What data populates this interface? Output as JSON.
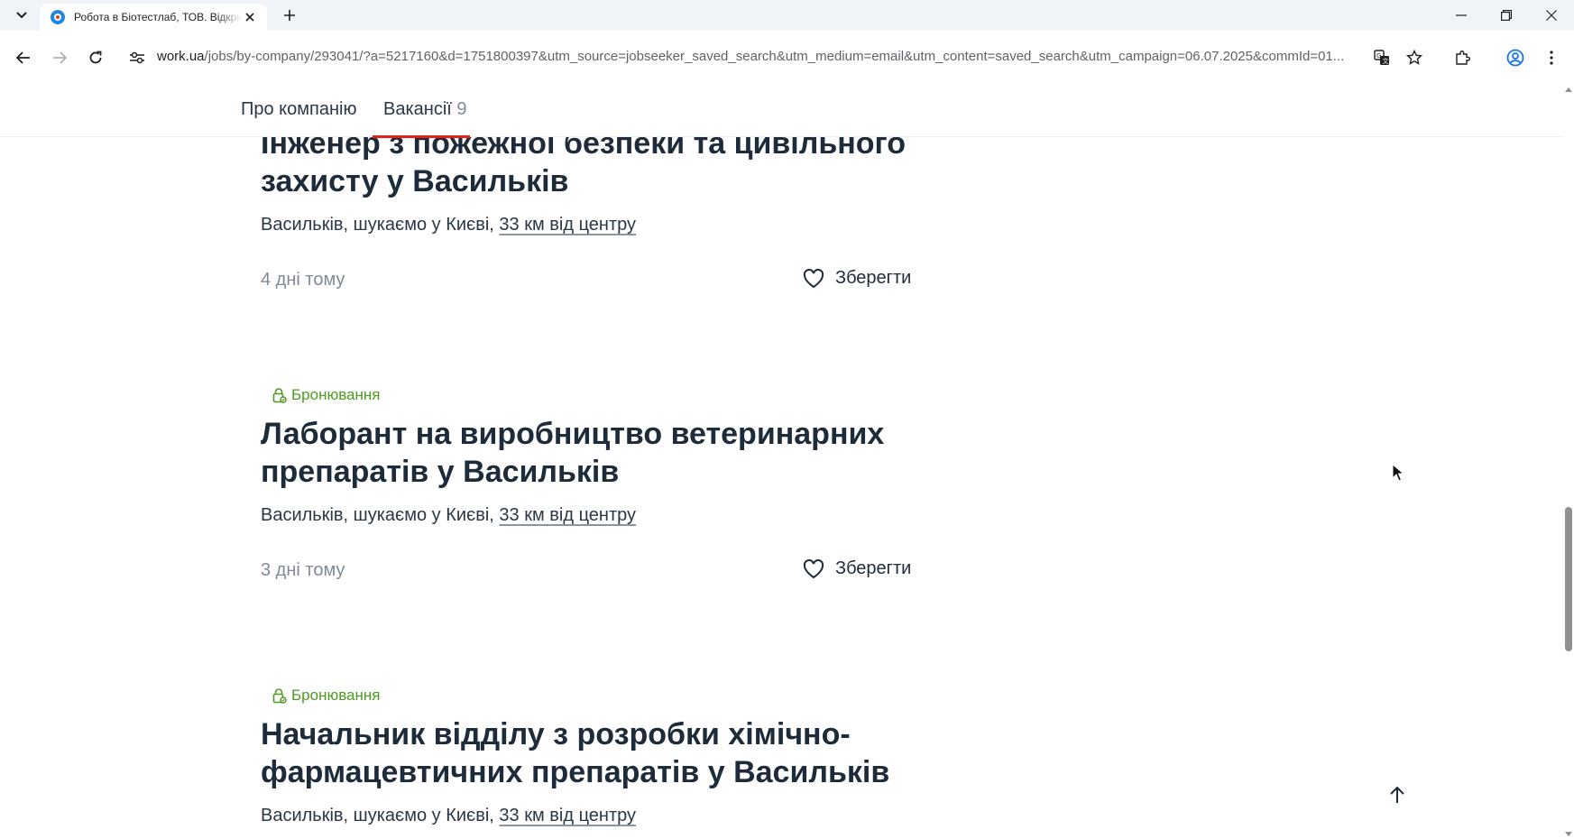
{
  "browser": {
    "tab": {
      "title": "Робота в Біотестлаб, ТОВ. Відкриті вакансії"
    },
    "address": {
      "domain": "work.ua",
      "path": "/jobs/by-company/293041/?a=5217160&d=1751800397&utm_source=jobseeker_saved_search&utm_medium=email&utm_content=saved_search&utm_campaign=06.07.2025&commId=01..."
    }
  },
  "sticky_nav": {
    "about_label": "Про компанію",
    "vacancies_label": "Вакансії",
    "vacancies_count": "9"
  },
  "jobs": [
    {
      "title": "Інженер з пожежної безпеки та цивільного захисту у Васильків",
      "location": "Васильків, шукаємо у Києві, ",
      "distance": "33 км від центру",
      "posted": "4 дні тому",
      "save_label": "Зберегти"
    },
    {
      "badge": "Бронювання",
      "title": "Лаборант на виробництво ветеринарних препаратів у Васильків",
      "location": "Васильків, шукаємо у Києві, ",
      "distance": "33 км від центру",
      "posted": "3 дні тому",
      "save_label": "Зберегти"
    },
    {
      "badge": "Бронювання",
      "title": "Начальник відділу з розробки хімічно-фармацевтичних препаратів у Васильків",
      "location": "Васильків, шукаємо у Києві, ",
      "distance": "33 км від центру"
    }
  ],
  "colors": {
    "badge_green": "#4f9a22",
    "accent_red": "#e2231a",
    "text_dark": "#1e2b3a",
    "text_muted": "#808b97"
  }
}
